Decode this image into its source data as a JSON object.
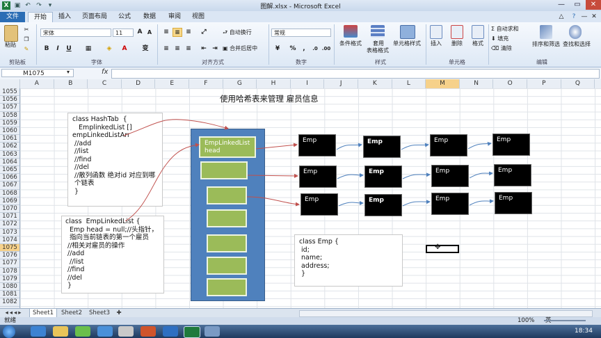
{
  "window": {
    "title": "图解.xlsx - Microsoft Excel"
  },
  "tabs": [
    "文件",
    "开始",
    "插入",
    "页面布局",
    "公式",
    "数据",
    "审阅",
    "视图"
  ],
  "ribbon": {
    "paste": "粘贴",
    "font_name": "宋体",
    "font_size": "11",
    "font_style_buttons": [
      "B",
      "I",
      "U"
    ],
    "wrap_text": "自动换行",
    "merge_center": "合并后居中",
    "number_format": "常规",
    "percent": "%",
    "comma": ",",
    "cond_format": "条件格式",
    "table_format_top": "套用",
    "table_format_bottom": "表格格式",
    "cell_styles": "单元格样式",
    "insert": "插入",
    "delete": "删除",
    "format": "格式",
    "autosum": "自动求和",
    "fill": "填充",
    "clear": "清除",
    "sort_filter": "排序和筛选",
    "find_select": "查找和选择",
    "groups": [
      "剪贴板",
      "字体",
      "对齐方式",
      "数字",
      "样式",
      "单元格",
      "编辑"
    ]
  },
  "formula_bar": {
    "name_box": "M1075",
    "fx": "fx"
  },
  "columns": [
    "A",
    "B",
    "C",
    "D",
    "E",
    "F",
    "G",
    "H",
    "I",
    "J",
    "K",
    "L",
    "M",
    "N",
    "O",
    "P",
    "Q"
  ],
  "rows": [
    "1055",
    "1056",
    "1057",
    "1058",
    "1059",
    "1060",
    "1061",
    "1062",
    "1063",
    "1064",
    "1065",
    "1066",
    "1067",
    "1068",
    "1069",
    "1070",
    "1071",
    "1072",
    "1073",
    "1074",
    "1075",
    "1076",
    "1077",
    "1078",
    "1079",
    "1080",
    "1081",
    "1082"
  ],
  "sheet": {
    "heading": "使用哈希表来管理 雇员信息",
    "hashtab_code": "class HashTab  {\n   EmplinkedList []\nempLinkedListArr\n //add\n //list\n //find\n //del\n //散列函数 绝对id 对应到哪\n 个链表\n }",
    "linkedlist_code": "class  EmpLinkedList {\n  Emp head = null;//头指针，\n  指向当前链表的第一个雇员\n //相关对雇员的操作\n //add\n  //list\n //find\n //del\n }",
    "emp_code": "class Emp {\n id;\n name;\n address;\n }",
    "linkedlist_head": "EmpLinkedList\nhead",
    "emp_label": "Emp"
  },
  "sheet_tabs": [
    "Sheet1",
    "Sheet2",
    "Sheet3"
  ],
  "status": {
    "ready": "就绪",
    "zoom": "100%",
    "ime": "英"
  },
  "clock": "18:34"
}
